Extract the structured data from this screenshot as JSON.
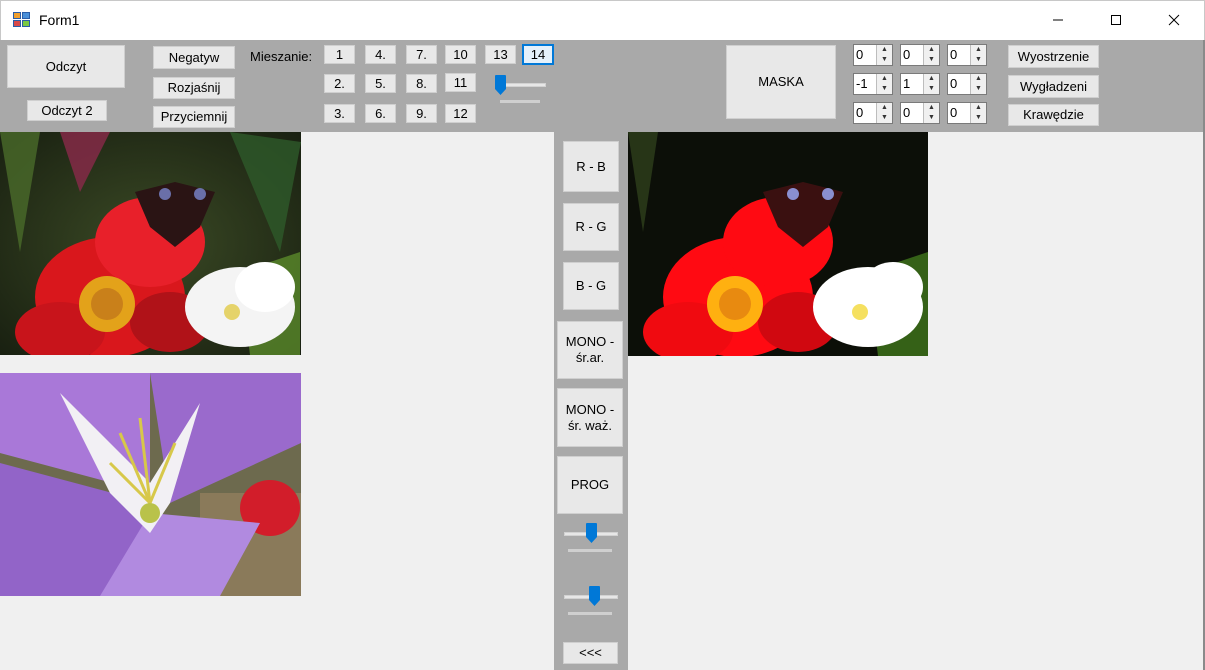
{
  "window": {
    "title": "Form1"
  },
  "toolbar": {
    "read_btn": "Odczyt",
    "read2_btn": "Odczyt 2",
    "negative_btn": "Negatyw",
    "brighten_btn": "Rozjaśnij",
    "darken_btn": "Przyciemnij",
    "blend_label": "Mieszanie:",
    "blend_buttons": [
      "1",
      "4.",
      "7.",
      "10",
      "13",
      "14",
      "2.",
      "5.",
      "8.",
      "11",
      "3.",
      "6.",
      "9.",
      "12"
    ],
    "mask_btn": "MASKA",
    "mask_values": [
      "0",
      "0",
      "0",
      "-1",
      "1",
      "0",
      "0",
      "0",
      "0"
    ],
    "sharpen_btn": "Wyostrzenie",
    "smooth_btn": "Wygładzeni",
    "edges_btn": "Krawędzie",
    "blend_slider_level": 0.0
  },
  "middle": {
    "rb_btn": "R - B",
    "rg_btn": "R - G",
    "bg_btn": "B - G",
    "mono_avg_btn": "MONO - śr.ar.",
    "mono_weighted_btn": "MONO - śr. waż.",
    "threshold_btn": "PROG",
    "back_btn": "<<<",
    "slider1_level": 0.5,
    "slider2_level": 0.55
  },
  "colors": {
    "toolbar_bg": "#a9a9a9",
    "accent": "#0078d7",
    "form_bg": "#f0f0f0"
  }
}
